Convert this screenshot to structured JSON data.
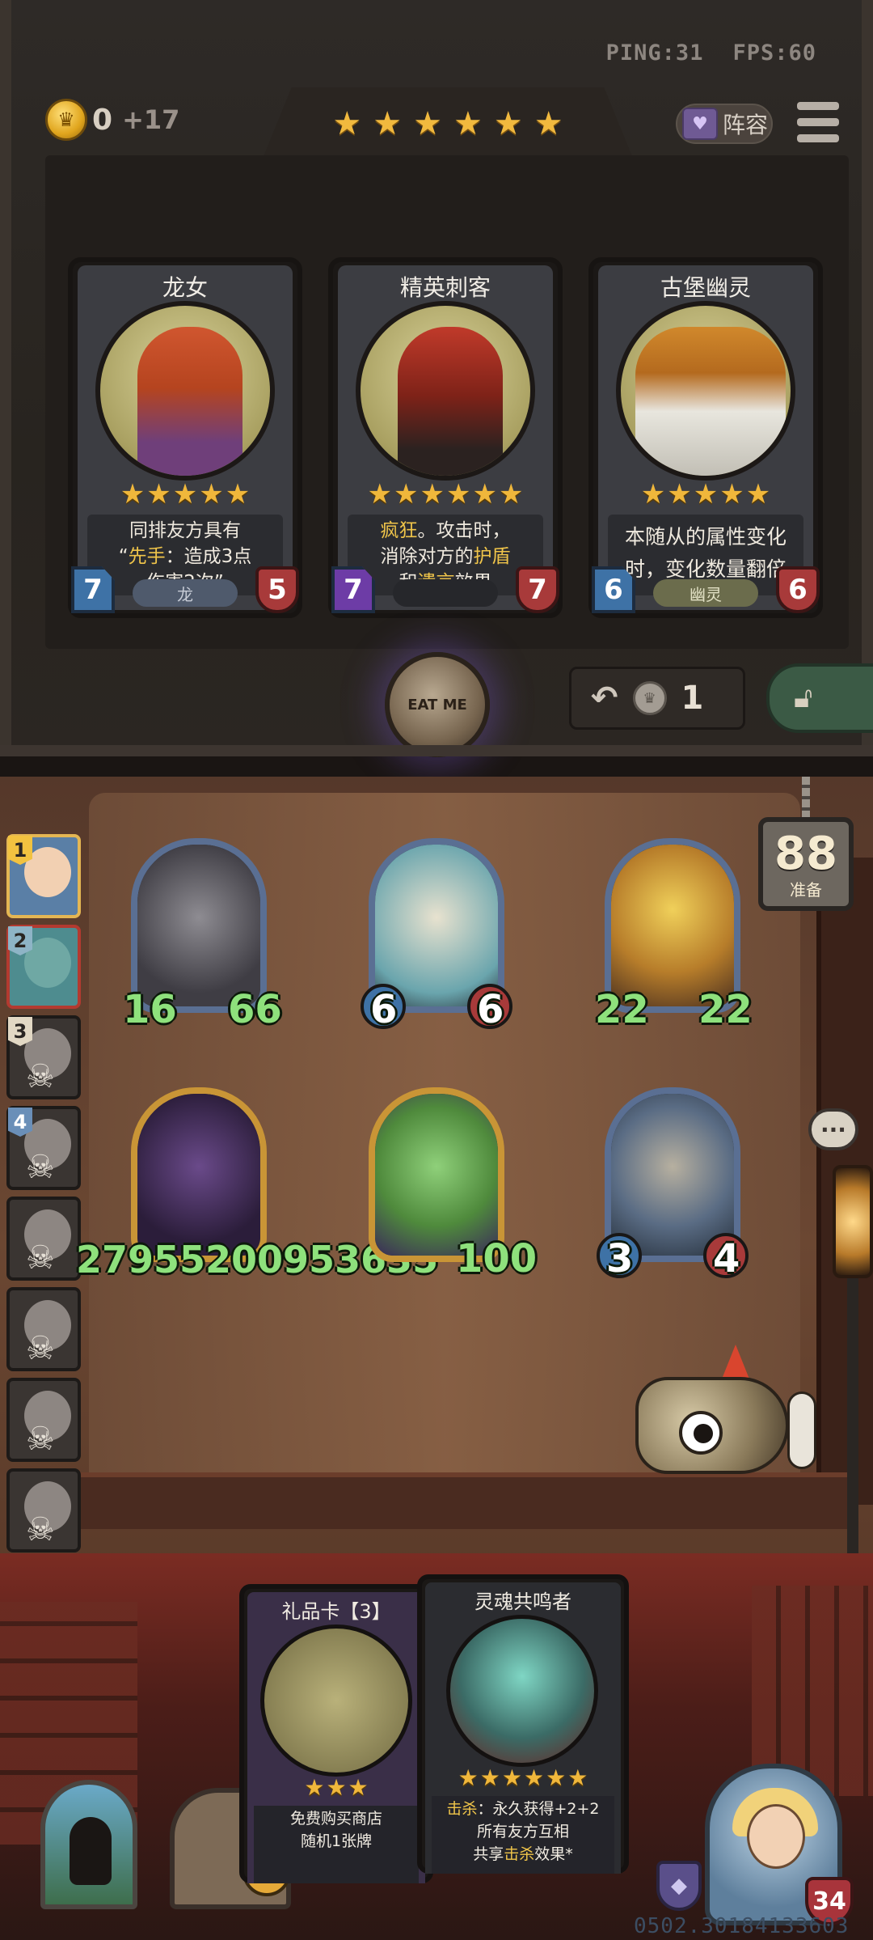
{
  "status": {
    "ping": "PING:31",
    "fps": "FPS:60"
  },
  "economy": {
    "gold": "0",
    "gold_gain": "+17"
  },
  "tavern_stars": [
    "★",
    "★",
    "★",
    "★",
    "★",
    "★"
  ],
  "header": {
    "lineup_label": "阵容"
  },
  "shop": {
    "cards": [
      {
        "name": "龙女",
        "stars": [
          "★",
          "★",
          "★",
          "★",
          "★"
        ],
        "desc_pre": "同排友方具有",
        "desc_line2_q": "“",
        "desc_hl": "先手",
        "desc_line2_rest": "：造成3点",
        "desc_line3": "伤害2次”",
        "attack": "7",
        "health": "5",
        "tribe": "龙"
      },
      {
        "name": "精英刺客",
        "stars": [
          "★",
          "★",
          "★",
          "★",
          "★",
          "★"
        ],
        "d1_hl": "疯狂",
        "d1_rest": "。攻击时，",
        "d2_pre": "消除对方的",
        "d2_hl": "护盾",
        "d3_pre": "和",
        "d3_hl": "遗言",
        "d3_rest": "效果",
        "attack": "7",
        "health": "7",
        "tribe": ""
      },
      {
        "name": "古堡幽灵",
        "stars": [
          "★",
          "★",
          "★",
          "★",
          "★"
        ],
        "desc_line1": "本随从的属性变化",
        "desc_line2": "时，变化数量翻倍",
        "attack": "6",
        "health": "6",
        "tribe": "幽灵"
      }
    ],
    "watch_label": "EAT ME",
    "refresh_cost": "1"
  },
  "board": {
    "ready_count": "88",
    "ready_label": "准备",
    "minions": [
      {
        "attack": "16",
        "health": "66"
      },
      {
        "attack": "6",
        "health": "6"
      },
      {
        "attack": "22",
        "health": "22"
      },
      {
        "attack": "27955200953635",
        "health": ""
      },
      {
        "attack": "",
        "health": "100"
      },
      {
        "attack": "3",
        "health": "4"
      }
    ]
  },
  "players": [
    {
      "rank": "1"
    },
    {
      "rank": "2"
    },
    {
      "rank": "3"
    },
    {
      "rank": "4"
    },
    {
      "rank": ""
    },
    {
      "rank": ""
    },
    {
      "rank": ""
    },
    {
      "rank": ""
    }
  ],
  "hand": [
    {
      "title": "礼品卡【3】",
      "stars": [
        "★",
        "★",
        "★"
      ],
      "line1": "免费购买商店",
      "line2": "随机1张牌"
    },
    {
      "title": "灵魂共鸣者",
      "stars": [
        "★",
        "★",
        "★",
        "★",
        "★",
        "★"
      ],
      "l1_hl": "击杀",
      "l1_rest": "：永久获得+2+2",
      "line2": "所有友方互相",
      "l3_pre": "共享",
      "l3_hl": "击杀",
      "l3_rest": "效果*"
    }
  ],
  "hero": {
    "health": "34"
  },
  "tavern": {
    "level": "1"
  },
  "build_id": "0502.30184133603",
  "colors": {
    "gold": "#f1b93e",
    "highlight": "#f0c54a",
    "attack_blue": "#3e72a6",
    "health_red": "#a83a3a",
    "buff_green": "#8ee17c"
  }
}
